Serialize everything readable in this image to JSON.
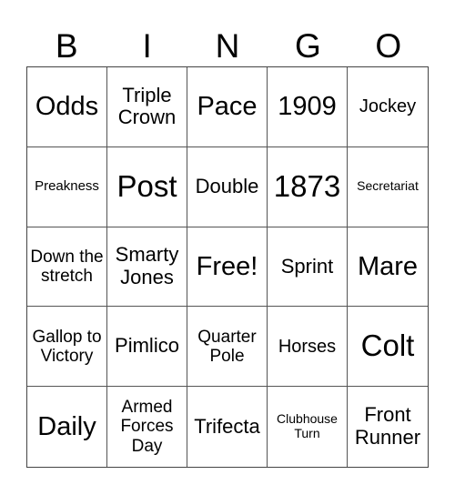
{
  "header": {
    "letters": [
      "B",
      "I",
      "N",
      "G",
      "O"
    ]
  },
  "cells": [
    [
      "Odds",
      "Triple Crown",
      "Pace",
      "1909",
      "Jockey"
    ],
    [
      "Preakness",
      "Post",
      "Double",
      "1873",
      "Secretariat"
    ],
    [
      "Down the stretch",
      "Smarty Jones",
      "Free!",
      "Sprint",
      "Mare"
    ],
    [
      "Gallop to Victory",
      "Pimlico",
      "Quarter Pole",
      "Horses",
      "Colt"
    ],
    [
      "Daily",
      "Armed Forces Day",
      "Trifecta",
      "Clubhouse Turn",
      "Front Runner"
    ]
  ]
}
